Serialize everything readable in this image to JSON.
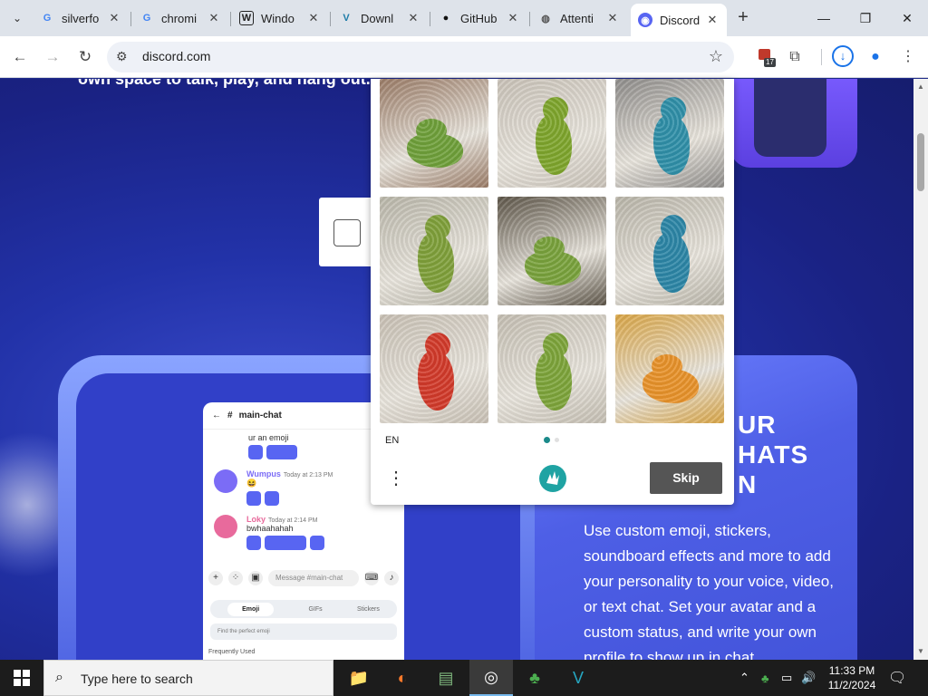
{
  "browser": {
    "tabs": [
      {
        "title": "silverfo",
        "icon": "google-icon",
        "favicon_text": "G"
      },
      {
        "title": "chromi",
        "icon": "google-icon",
        "favicon_text": "G"
      },
      {
        "title": "Windo",
        "icon": "wikipedia-icon",
        "favicon_text": "W"
      },
      {
        "title": "Downl",
        "icon": "vs-icon",
        "favicon_text": "V"
      },
      {
        "title": "GitHub",
        "icon": "github-icon",
        "favicon_text": "●"
      },
      {
        "title": "Attenti",
        "icon": "globe-icon",
        "favicon_text": "◍"
      },
      {
        "title": "Discord",
        "icon": "discord-icon",
        "favicon_text": "◉",
        "active": true
      }
    ],
    "tab_close": "✕",
    "new_tab": "+",
    "tab_search": "⌄",
    "window_controls": {
      "minimize": "—",
      "maximize": "❐",
      "close": "✕"
    },
    "nav": {
      "back": "←",
      "forward": "→",
      "reload": "↻"
    },
    "address": {
      "site_info": "⚙",
      "url": "discord.com",
      "bookmark": "☆"
    },
    "extensions": {
      "badge_count": "17",
      "puzzle": "⧉",
      "download": "↓",
      "profile": "●",
      "menu": "⋮"
    }
  },
  "page": {
    "hero_tagline": "own space to talk, play, and hang out.",
    "feature_heading_lines": [
      "UR",
      "HATS",
      "N"
    ],
    "feature_text": "Use custom emoji, stickers, soundboard effects and more to add your personality to your voice, video, or text chat. Set your avatar and a custom status, and write your own profile to show up in chat",
    "mock_chat": {
      "channel": "main-chat",
      "back": "←",
      "hash": "#",
      "first_line": "ur an emoji",
      "messages": [
        {
          "name": "Wumpus",
          "time": "Today at 2:13 PM",
          "text": "😆",
          "color": "#7b6cf6"
        },
        {
          "name": "Loky",
          "time": "Today at 2:14 PM",
          "text": "bwhaahahah",
          "color": "#e86a9c"
        }
      ],
      "input_placeholder": "Message #main-chat",
      "tabs": [
        "Emoji",
        "GIFs",
        "Stickers"
      ],
      "search_placeholder": "Find the perfect emoji",
      "section": "Frequently Used"
    }
  },
  "captcha": {
    "language": "EN",
    "skip_label": "Skip",
    "menu": "⋮",
    "tiles": [
      {
        "subject": "frog",
        "bg": "#9a7b66",
        "body": "#6fa03a"
      },
      {
        "subject": "green parrot",
        "bg": "#c9c2b8",
        "body": "#7ea52c"
      },
      {
        "subject": "blue parrot",
        "bg": "#8e8c8a",
        "body": "#2f8fa8"
      },
      {
        "subject": "green parrot",
        "bg": "#b9b6a9",
        "body": "#7fa03a"
      },
      {
        "subject": "frog",
        "bg": "#5d5548",
        "body": "#79a23c"
      },
      {
        "subject": "blue parrot",
        "bg": "#b8b4a8",
        "body": "#2c86a6"
      },
      {
        "subject": "red parrot",
        "bg": "#c8c0b4",
        "body": "#d23a2a"
      },
      {
        "subject": "green parrot",
        "bg": "#c4beb2",
        "body": "#7da43a"
      },
      {
        "subject": "orange frog",
        "bg": "#d9a545",
        "body": "#e8922a"
      }
    ],
    "colors": {
      "skip_bg": "#555555",
      "dot_active": "#1b8a8a",
      "logo": "#1fa3a3"
    }
  },
  "taskbar": {
    "search_placeholder": "Type here to search",
    "apps": [
      {
        "name": "file-explorer",
        "glyph": "📁"
      },
      {
        "name": "firefox",
        "glyph": "◐"
      },
      {
        "name": "notepad",
        "glyph": "▤"
      },
      {
        "name": "chrome",
        "glyph": "◎",
        "active": true
      },
      {
        "name": "people-app",
        "glyph": "♣"
      },
      {
        "name": "vs-app",
        "glyph": "V"
      }
    ],
    "tray": {
      "chevron": "⌃",
      "wifi": "▭",
      "volume": "🔊"
    },
    "time": "11:33 PM",
    "date": "11/2/2024",
    "notifications": "🗨"
  }
}
